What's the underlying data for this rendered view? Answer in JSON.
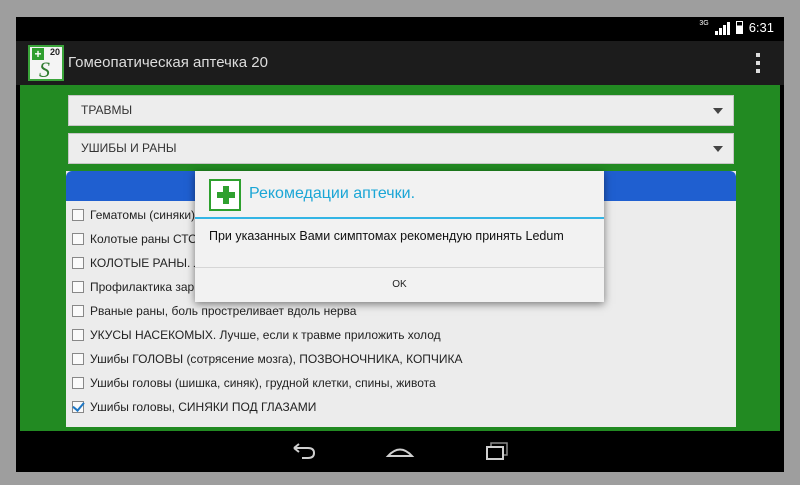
{
  "status": {
    "network": "3G",
    "time": "6:31"
  },
  "app": {
    "title": "Гомеопатическая аптечка 20",
    "icon_number": "20",
    "icon_letter": "S"
  },
  "spinners": {
    "category": "ТРАВМЫ",
    "subcategory": "УШИБЫ И РАНЫ"
  },
  "list": {
    "items": [
      {
        "label": "Гематомы (синяки)",
        "checked": false
      },
      {
        "label": "Колотые раны СТО",
        "checked": false
      },
      {
        "label": "КОЛОТЫЕ РАНЫ. Л",
        "checked": false
      },
      {
        "label": "Профилактика зар",
        "checked": false
      },
      {
        "label": "Рваные раны, боль простреливает вдоль нерва",
        "checked": false
      },
      {
        "label": "УКУСЫ НАСЕКОМЫХ. Лучше, если к травме приложить холод",
        "checked": false
      },
      {
        "label": "Ушибы ГОЛОВЫ (сотрясение мозга), ПОЗВОНОЧНИКА, КОПЧИКА",
        "checked": false
      },
      {
        "label": "Ушибы головы (шишка, синяк), грудной клетки, спины, живота",
        "checked": false
      },
      {
        "label": "Ушибы головы, СИНЯКИ ПОД ГЛАЗАМИ",
        "checked": true
      }
    ]
  },
  "dialog": {
    "title": "Рекомедации аптечки.",
    "message": "При указанных Вами симптомах рекомендую принять Ledum",
    "ok_label": "OK"
  },
  "colors": {
    "accent": "#33b5e5",
    "content_bg": "#228a22",
    "list_header": "#1f5fd0"
  }
}
